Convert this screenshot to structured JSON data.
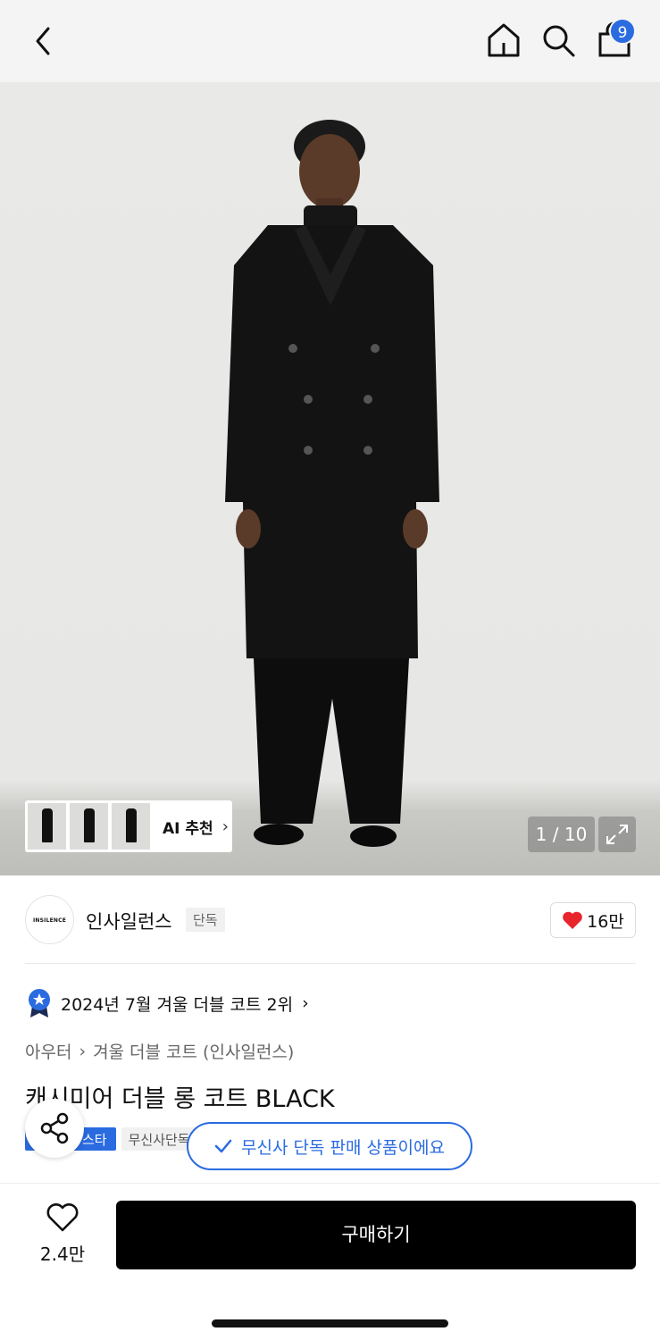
{
  "header": {
    "cart_count": "9"
  },
  "hero": {
    "ai_recommend_label": "AI 추천",
    "pager": "1 / 10"
  },
  "brand": {
    "logo_text": "INSILENCE",
    "name": "인사일런스",
    "exclusive_tag": "단독",
    "likes": "16만"
  },
  "ranking": {
    "text": "2024년 7월 겨울 더블 코트 2위"
  },
  "breadcrumb": {
    "category": "아우터",
    "subcategory": "겨울 더블 코트 (인사일런스)"
  },
  "product": {
    "title": "캐시미어 더블 롱 코트 BLACK",
    "tag_blue": "스타",
    "tag_grey": "무신사단독"
  },
  "toast": {
    "text": "무신사 단독 판매 상품이에요"
  },
  "bottom_bar": {
    "wish_count": "2.4만",
    "buy_label": "구매하기"
  },
  "colors": {
    "accent": "#2a6be0",
    "heart": "#e8242c",
    "buy_button": "#000000"
  }
}
